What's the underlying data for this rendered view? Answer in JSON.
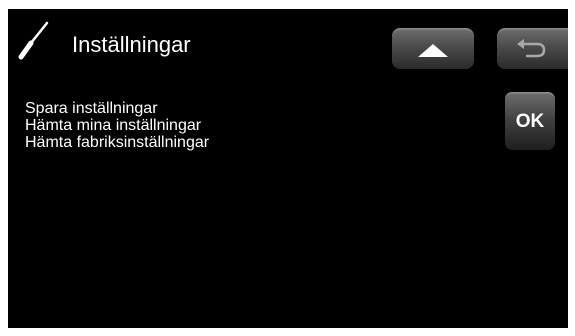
{
  "header": {
    "title": "Inställningar",
    "icon": "screwdriver-icon",
    "home_icon": "home-icon",
    "back_icon": "back-arrow-icon"
  },
  "menu": {
    "items": [
      {
        "label": "Spara inställningar"
      },
      {
        "label": "Hämta mina inställningar"
      },
      {
        "label": "Hämta fabriksinställningar"
      }
    ]
  },
  "ok_button": {
    "label": "OK"
  },
  "colors": {
    "background": "#000000",
    "text": "#ffffff",
    "button_top": "#6d6d6d",
    "button_bottom": "#2b2b2b"
  }
}
